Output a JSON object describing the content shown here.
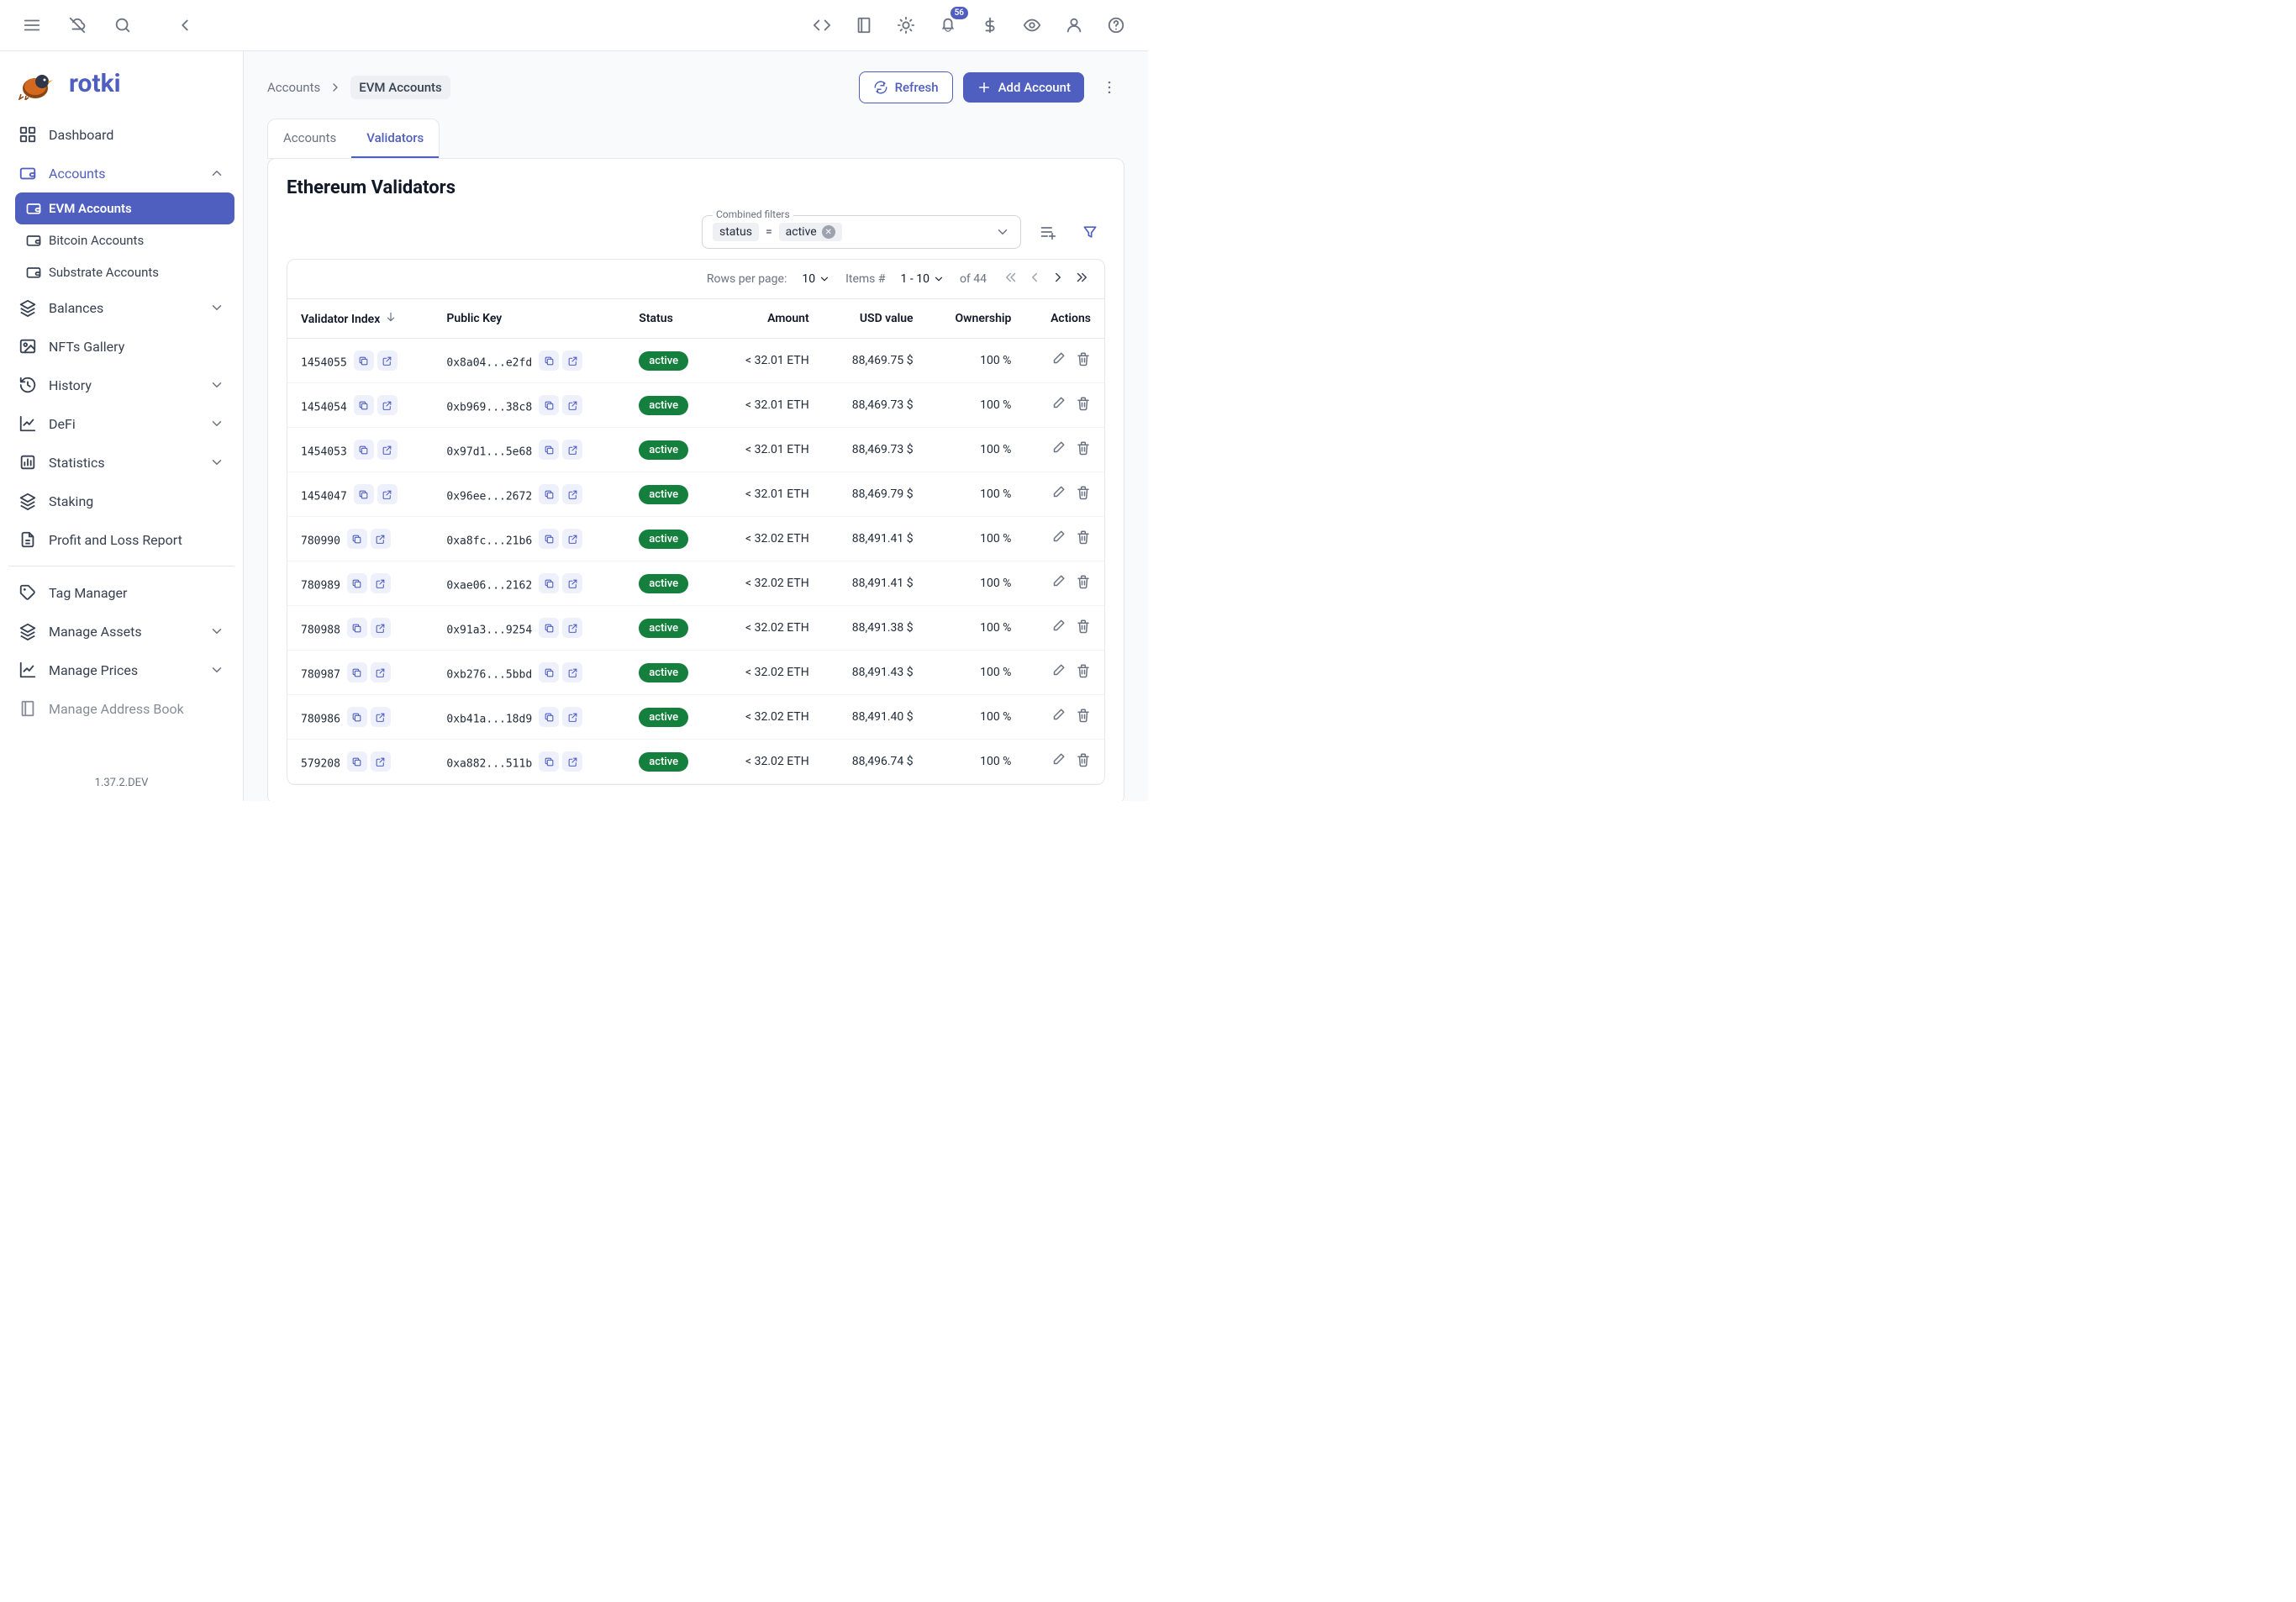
{
  "topbar": {
    "notification_count": "56"
  },
  "logo": {
    "text": "rotki"
  },
  "sidebar": {
    "items": [
      {
        "label": "Dashboard"
      },
      {
        "label": "Accounts"
      },
      {
        "label": "Balances"
      },
      {
        "label": "NFTs Gallery"
      },
      {
        "label": "History"
      },
      {
        "label": "DeFi"
      },
      {
        "label": "Statistics"
      },
      {
        "label": "Staking"
      },
      {
        "label": "Profit and Loss Report"
      }
    ],
    "accounts_sub": [
      {
        "label": "EVM Accounts"
      },
      {
        "label": "Bitcoin Accounts"
      },
      {
        "label": "Substrate Accounts"
      }
    ],
    "lower": [
      {
        "label": "Tag Manager"
      },
      {
        "label": "Manage Assets"
      },
      {
        "label": "Manage Prices"
      },
      {
        "label": "Manage Address Book"
      }
    ],
    "version": "1.37.2.DEV"
  },
  "breadcrumb": {
    "root": "Accounts",
    "current": "EVM Accounts"
  },
  "actions": {
    "refresh": "Refresh",
    "add": "Add Account"
  },
  "tabs": {
    "accounts": "Accounts",
    "validators": "Validators"
  },
  "panel": {
    "title": "Ethereum Validators"
  },
  "filter": {
    "legend": "Combined filters",
    "key": "status",
    "op": "=",
    "value": "active"
  },
  "table": {
    "rows_per_page_label": "Rows per page:",
    "rows_per_page": "10",
    "items_label": "Items #",
    "range": "1 - 10",
    "of_total": "of 44",
    "columns": {
      "index": "Validator Index",
      "pubkey": "Public Key",
      "status": "Status",
      "amount": "Amount",
      "usd": "USD value",
      "ownership": "Ownership",
      "actions": "Actions"
    },
    "rows": [
      {
        "index": "1454055",
        "pubkey": "0x8a04...e2fd",
        "status": "active",
        "amount": "< 32.01 ETH",
        "usd": "88,469.75 $",
        "ownership": "100 %"
      },
      {
        "index": "1454054",
        "pubkey": "0xb969...38c8",
        "status": "active",
        "amount": "< 32.01 ETH",
        "usd": "88,469.73 $",
        "ownership": "100 %"
      },
      {
        "index": "1454053",
        "pubkey": "0x97d1...5e68",
        "status": "active",
        "amount": "< 32.01 ETH",
        "usd": "88,469.73 $",
        "ownership": "100 %"
      },
      {
        "index": "1454047",
        "pubkey": "0x96ee...2672",
        "status": "active",
        "amount": "< 32.01 ETH",
        "usd": "88,469.79 $",
        "ownership": "100 %"
      },
      {
        "index": "780990",
        "pubkey": "0xa8fc...21b6",
        "status": "active",
        "amount": "< 32.02 ETH",
        "usd": "88,491.41 $",
        "ownership": "100 %"
      },
      {
        "index": "780989",
        "pubkey": "0xae06...2162",
        "status": "active",
        "amount": "< 32.02 ETH",
        "usd": "88,491.41 $",
        "ownership": "100 %"
      },
      {
        "index": "780988",
        "pubkey": "0x91a3...9254",
        "status": "active",
        "amount": "< 32.02 ETH",
        "usd": "88,491.38 $",
        "ownership": "100 %"
      },
      {
        "index": "780987",
        "pubkey": "0xb276...5bbd",
        "status": "active",
        "amount": "< 32.02 ETH",
        "usd": "88,491.43 $",
        "ownership": "100 %"
      },
      {
        "index": "780986",
        "pubkey": "0xb41a...18d9",
        "status": "active",
        "amount": "< 32.02 ETH",
        "usd": "88,491.40 $",
        "ownership": "100 %"
      },
      {
        "index": "579208",
        "pubkey": "0xa882...511b",
        "status": "active",
        "amount": "< 32.02 ETH",
        "usd": "88,496.74 $",
        "ownership": "100 %"
      }
    ]
  }
}
